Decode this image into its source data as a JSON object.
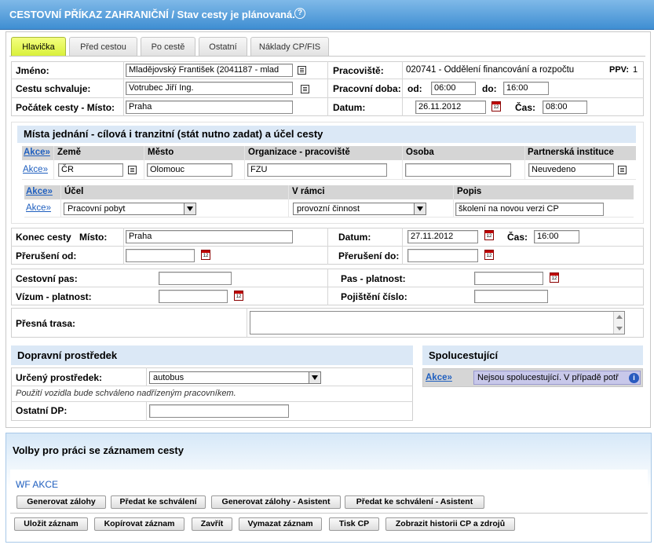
{
  "header": {
    "title": "CESTOVNÍ PŘÍKAZ ZAHRANIČNÍ / Stav cesty je plánovaná.",
    "help": "?"
  },
  "tabs": [
    "Hlavička",
    "Před cestou",
    "Po cestě",
    "Ostatní",
    "Náklady CP/FIS"
  ],
  "form": {
    "jmeno_label": "Jméno:",
    "jmeno_value": "Mladějovský František  (2041187 - mlad",
    "pracoviste_label": "Pracoviště:",
    "pracoviste_value": "020741 - Oddělení financování a rozpočtu",
    "ppv_label": "PPV:",
    "ppv_value": "1",
    "schvaluje_label": "Cestu schvaluje:",
    "schvaluje_value": "Votrubec Jiří Ing.",
    "doba_label": "Pracovní doba:",
    "od_label": "od:",
    "od_value": "06:00",
    "do_label": "do:",
    "do_value": "16:00",
    "pocatek_label": "Počátek cesty - Místo:",
    "pocatek_value": "Praha",
    "datum_label": "Datum:",
    "datum_value": "26.11.2012",
    "cas_label": "Čas:",
    "cas_value": "08:00"
  },
  "mista": {
    "title": "Místa jednání - cílová i tranzitní (stát nutno zadat) a účel cesty",
    "cols": [
      "Akce»",
      "Země",
      "Město",
      "Organizace - pracoviště",
      "Osoba",
      "Partnerská instituce"
    ],
    "row": {
      "akce": "Akce»",
      "zeme": "ČR",
      "mesto": "Olomouc",
      "org": "FZU",
      "osoba": "",
      "partner": "Neuvedeno"
    },
    "ucel_cols": [
      "Akce»",
      "Účel",
      "V rámci",
      "Popis"
    ],
    "ucel_row": {
      "akce": "Akce»",
      "ucel": "Pracovní pobyt",
      "ramci": "provozní činnost",
      "popis": "školení na novou verzi CP"
    }
  },
  "konec": {
    "label": "Konec cesty",
    "misto_label": "Místo:",
    "misto_value": "Praha",
    "datum_label": "Datum:",
    "datum_value": "27.11.2012",
    "cas_label": "Čas:",
    "cas_value": "16:00",
    "preruseni_od_label": "Přerušení od:",
    "preruseni_do_label": "Přerušení do:"
  },
  "pas": {
    "cestovni_pas_label": "Cestovní pas:",
    "pas_platnost_label": "Pas - platnost:",
    "vizum_label": "Vízum - platnost:",
    "pojisteni_label": "Pojištění číslo:",
    "trasa_label": "Přesná trasa:"
  },
  "doprava": {
    "title": "Dopravní prostředek",
    "urceny_label": "Určený prostředek:",
    "urceny_value": "autobus",
    "note": "Použití vozidla bude schváleno nadřízeným pracovníkem.",
    "ostatni_label": "Ostatní DP:"
  },
  "spolu": {
    "title": "Spolucestující",
    "akce": "Akce»",
    "text": "Nejsou spolucestující. V případě potř"
  },
  "volby": {
    "title": "Volby pro práci se záznamem cesty",
    "wf": "WF AKCE",
    "wf_buttons": [
      "Generovat zálohy",
      "Předat ke schválení",
      "Generovat zálohy - Asistent",
      "Předat ke schválení - Asistent"
    ],
    "buttons": [
      "Uložit záznam",
      "Kopírovat záznam",
      "Zavřít",
      "Vymazat záznam",
      "Tisk CP",
      "Zobrazit historii CP a zdrojů"
    ]
  },
  "colors": {
    "title_bar": "#3f8ed2",
    "active_tab": "#d9f03a",
    "section_head": "#dbe8f6",
    "link": "#1f5fbf"
  }
}
